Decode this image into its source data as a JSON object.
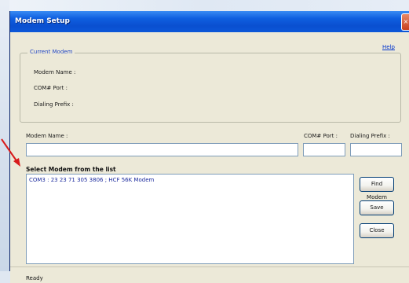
{
  "window": {
    "title": "Modem Setup",
    "close_glyph": "×"
  },
  "help_link": "Help",
  "current_modem": {
    "legend": "Current Modem",
    "name_label": "Modem Name :",
    "port_label": "COM# Port :",
    "prefix_label": "Dialing Prefix :"
  },
  "fields": {
    "modem_name_label": "Modem Name :",
    "com_port_label": "COM# Port :",
    "dialing_prefix_label": "Dialing Prefix :",
    "modem_name_value": "",
    "com_port_value": "",
    "dialing_prefix_value": ""
  },
  "list": {
    "heading": "Select Modem from the list",
    "items": [
      "COM3 : 23 23 71 305 3806 ; HCF 56K Modem"
    ]
  },
  "buttons": {
    "find": "Find Modem",
    "save": "Save",
    "close": "Close"
  },
  "status": {
    "text": "Ready"
  },
  "colors": {
    "accent": "#0a4fd0",
    "arrow": "#d81b1b"
  }
}
